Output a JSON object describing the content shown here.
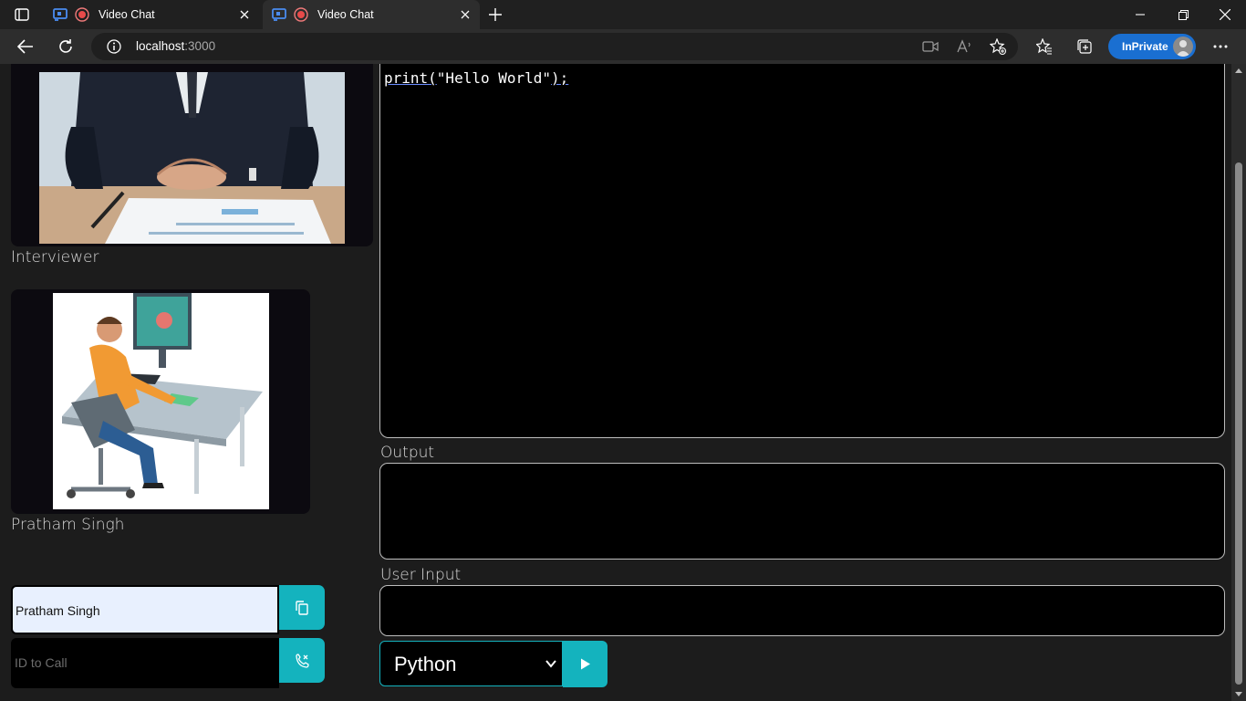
{
  "browser": {
    "tabs": [
      {
        "title": "Video Chat",
        "active": false
      },
      {
        "title": "Video Chat",
        "active": true
      }
    ],
    "url_host": "localhost",
    "url_port": ":3000",
    "inprivate_label": "InPrivate",
    "accent_color": "#1a6fd1"
  },
  "videos": {
    "interviewer_label": "Interviewer",
    "candidate_label": "Pratham Singh"
  },
  "call": {
    "name_value": "Pratham Singh",
    "id_placeholder": "ID to Call",
    "copy_icon": "copy-icon",
    "call_icon": "phone-call-icon"
  },
  "editor": {
    "code_func": "print(",
    "code_arg": "\"Hello World\"",
    "code_end": ");"
  },
  "output": {
    "label": "Output",
    "value": ""
  },
  "user_input": {
    "label": "User Input",
    "value": ""
  },
  "language": {
    "selected": "Python",
    "run_icon": "play-icon"
  },
  "colors": {
    "teal": "#14b3be",
    "background": "#1c1c1c"
  }
}
